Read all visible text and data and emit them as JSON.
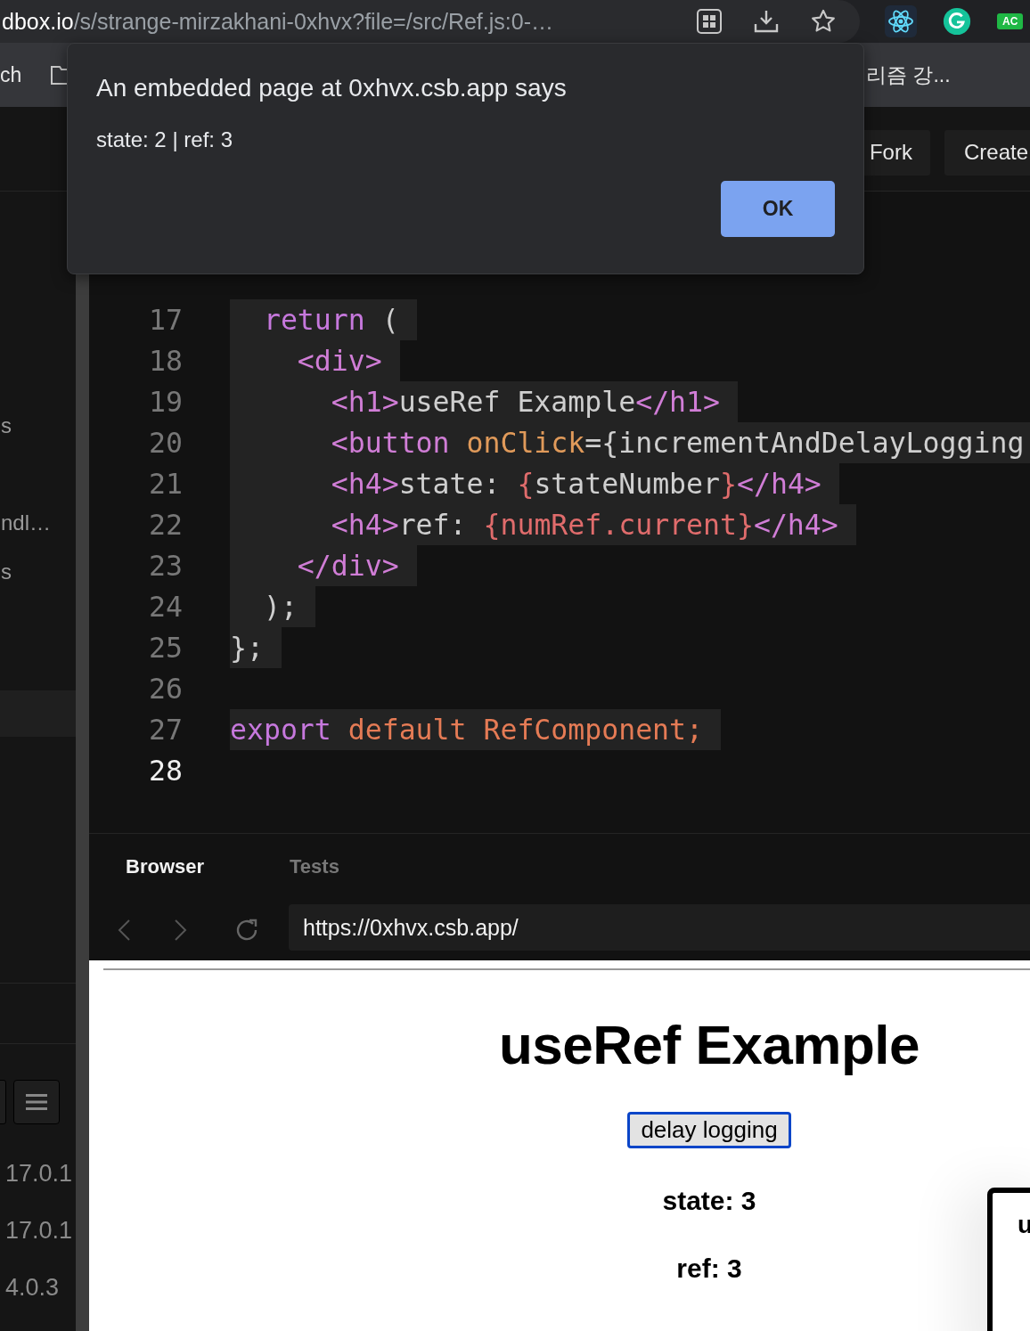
{
  "browser": {
    "address_host": "dbox.io",
    "address_path": "/s/strange-mirzakhani-0xhvx?file=/src/Ref.js:0-…",
    "extension_badge": "AC"
  },
  "bookmarks": {
    "left_text": "ch",
    "right_text": "리즘 강..."
  },
  "header": {
    "buttons": [
      "Fork",
      "Create"
    ]
  },
  "sidebar": {
    "items": [
      "s",
      "ndl…",
      "s"
    ],
    "versions": [
      "17.0.1",
      "17.0.1",
      "4.0.3"
    ]
  },
  "editor": {
    "lines": [
      {
        "number": "17",
        "tokens": [
          {
            "text": "  return",
            "kind": "keyword"
          },
          {
            "text": " (",
            "kind": "plain"
          }
        ]
      },
      {
        "number": "18",
        "tokens": [
          {
            "text": "    <div>",
            "kind": "tag"
          }
        ]
      },
      {
        "number": "19",
        "tokens": [
          {
            "text": "      <h1>",
            "kind": "tag"
          },
          {
            "text": "useRef Example",
            "kind": "plain"
          },
          {
            "text": "</h1>",
            "kind": "tag"
          }
        ]
      },
      {
        "number": "20",
        "tokens": [
          {
            "text": "      <button",
            "kind": "tag"
          },
          {
            "text": " onClick",
            "kind": "attr"
          },
          {
            "text": "={incrementAndDelayLogging",
            "kind": "plain"
          }
        ]
      },
      {
        "number": "21",
        "tokens": [
          {
            "text": "      <h4>",
            "kind": "tag"
          },
          {
            "text": "state: ",
            "kind": "plain"
          },
          {
            "text": "{",
            "kind": "expr"
          },
          {
            "text": "stateNumber",
            "kind": "plain"
          },
          {
            "text": "}",
            "kind": "expr"
          },
          {
            "text": "</h4>",
            "kind": "tag"
          }
        ]
      },
      {
        "number": "22",
        "tokens": [
          {
            "text": "      <h4>",
            "kind": "tag"
          },
          {
            "text": "ref: ",
            "kind": "plain"
          },
          {
            "text": "{numRef.current}",
            "kind": "expr"
          },
          {
            "text": "</h4>",
            "kind": "tag"
          }
        ]
      },
      {
        "number": "23",
        "tokens": [
          {
            "text": "    </div>",
            "kind": "tag"
          }
        ]
      },
      {
        "number": "24",
        "tokens": [
          {
            "text": "  );",
            "kind": "plain"
          }
        ]
      },
      {
        "number": "25",
        "tokens": [
          {
            "text": "};",
            "kind": "plain"
          }
        ]
      },
      {
        "number": "26"
      },
      {
        "number": "27",
        "tokens": [
          {
            "text": "export",
            "kind": "keyword"
          },
          {
            "text": " default RefComponent;",
            "kind": "name"
          }
        ]
      },
      {
        "number": "28",
        "current": true
      }
    ]
  },
  "preview": {
    "tabs": [
      {
        "label": "Browser",
        "selected": true
      },
      {
        "label": "Tests",
        "selected": false
      }
    ],
    "url": "https://0xhvx.csb.app/",
    "page": {
      "title": "useRef Example",
      "button": "delay logging",
      "button_focused": true,
      "lines": [
        "state: 3",
        "ref: 3"
      ]
    },
    "popup_text": "u"
  },
  "dialog": {
    "title": "An embedded page at 0xhvx.csb.app says",
    "message": "state: 2 | ref: 3",
    "button": "OK"
  }
}
